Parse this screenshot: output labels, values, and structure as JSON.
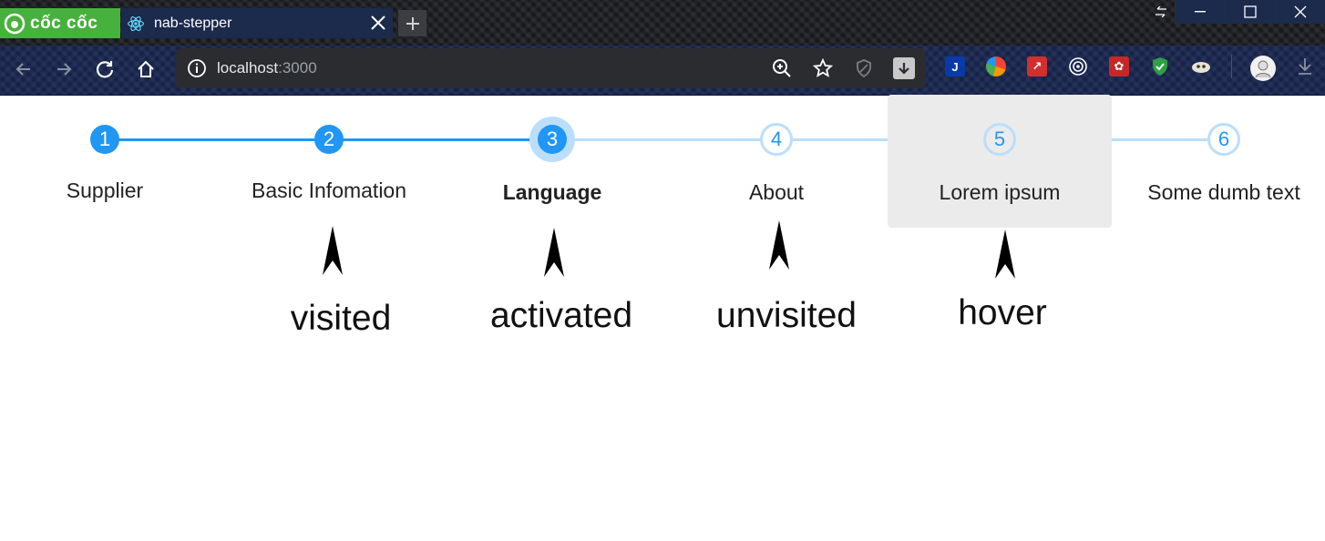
{
  "browser": {
    "brand_label": "cốc cốc",
    "tab_title": "nab-stepper",
    "url_host": "localhost",
    "url_port": ":3000",
    "icons": [
      "back-icon",
      "forward-icon",
      "reload-icon",
      "home-icon",
      "info-icon",
      "zoom-icon",
      "star-icon",
      "shield-icon",
      "download-icon",
      "minimize-icon",
      "maximize-icon",
      "close-icon"
    ]
  },
  "stepper": {
    "colors": {
      "primary": "#2196f3",
      "light": "#bbdefb",
      "hover_bg": "#ebebeb"
    },
    "steps": [
      {
        "number": "1",
        "label": "Supplier",
        "state": "visited"
      },
      {
        "number": "2",
        "label": "Basic Infomation",
        "state": "visited"
      },
      {
        "number": "3",
        "label": "Language",
        "state": "activated"
      },
      {
        "number": "4",
        "label": "About",
        "state": "unvisited"
      },
      {
        "number": "5",
        "label": "Lorem ipsum",
        "state": "hover"
      },
      {
        "number": "6",
        "label": "Some dumb text",
        "state": "unvisited"
      }
    ]
  },
  "annotations": {
    "visited": "visited",
    "activated": "activated",
    "unvisited": "unvisited",
    "hover": "hover"
  }
}
